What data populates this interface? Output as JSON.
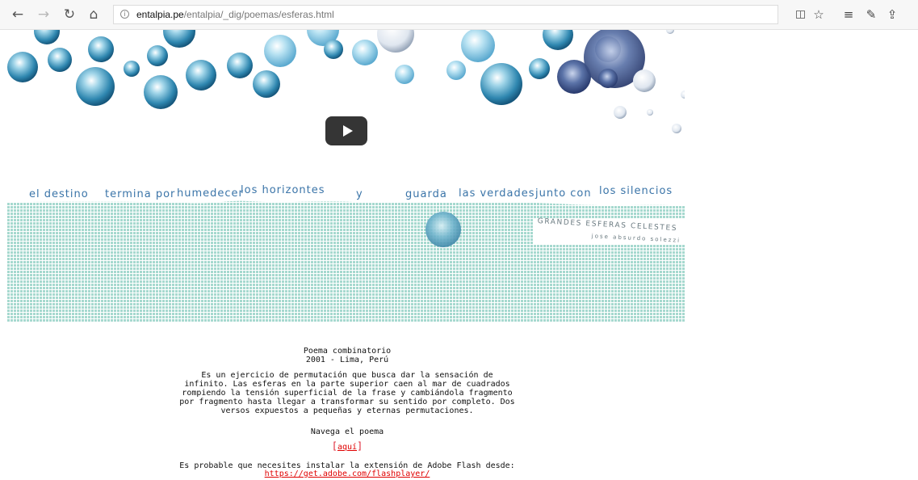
{
  "browser": {
    "url_domain": "entalpia.pe",
    "url_path": "/entalpia/_dig/poemas/esferas.html",
    "icons": [
      "back-icon",
      "forward-icon",
      "refresh-icon",
      "home-icon",
      "site-info-icon",
      "reading-view-icon",
      "favorite-star-icon",
      "favorites-list-icon",
      "notes-pen-icon",
      "share-icon"
    ]
  },
  "flash": {
    "poem_words": [
      "el destino",
      "termina por",
      "humedecer",
      "los horizontes",
      "y",
      "guarda",
      "las verdades",
      "junto con",
      "los silencios"
    ],
    "title_label": "GRANDES ESFERAS CELESTES",
    "author_label": "jose absurdo solezzi"
  },
  "content": {
    "heading_line1": "Poema combinatorio",
    "heading_line2": "2001 - Lima, Perú",
    "paragraph_lines": [
      "Es un ejercicio de permutación que busca dar la sensación de",
      "infinito. Las esferas en la parte superior caen al mar de cuadrados",
      "rompiendo la tensión superficial de la frase y cambiándola fragmento",
      "por fragmento hasta llegar a transformar su sentido por completo. Dos",
      "versos expuestos a pequeñas y eternas permutaciones."
    ],
    "navigate_label": "Navega el poema",
    "link_aqui": "aquí",
    "flash_note": "Es probable que necesites instalar la extensión de Adobe Flash desde:",
    "flash_link": "https://get.adobe.com/flashplayer/"
  },
  "colors": {
    "accent_blue": "#3a74a8",
    "sea_green": "#a6d9cf",
    "link_red": "#e00000"
  }
}
